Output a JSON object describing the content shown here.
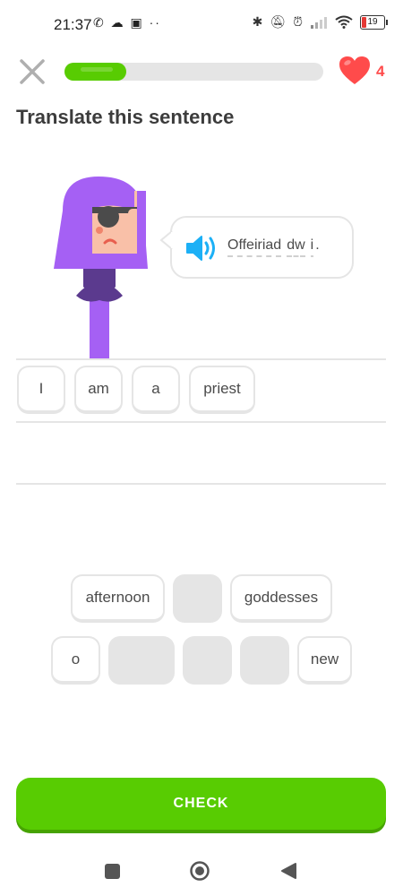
{
  "status_bar": {
    "time": "21:37",
    "left_icons": "✆ ☁ ▣ ··",
    "battery": "19"
  },
  "header": {
    "progress_fraction": 0.24,
    "hearts": "4"
  },
  "title": "Translate this sentence",
  "prompt_sentence": [
    "Offeiriad",
    "dw",
    "i",
    "."
  ],
  "answer_tiles": [
    "I",
    "am",
    "a",
    "priest"
  ],
  "word_bank": {
    "row1": [
      "afternoon",
      "",
      "goddesses"
    ],
    "row2": [
      "o",
      "",
      "",
      "",
      "new"
    ]
  },
  "check_label": "CHECK",
  "colors": {
    "accent": "#58cc02",
    "heart": "#ff4b4b",
    "speaker": "#1cb0f6",
    "character_hair": "#a560f4"
  }
}
